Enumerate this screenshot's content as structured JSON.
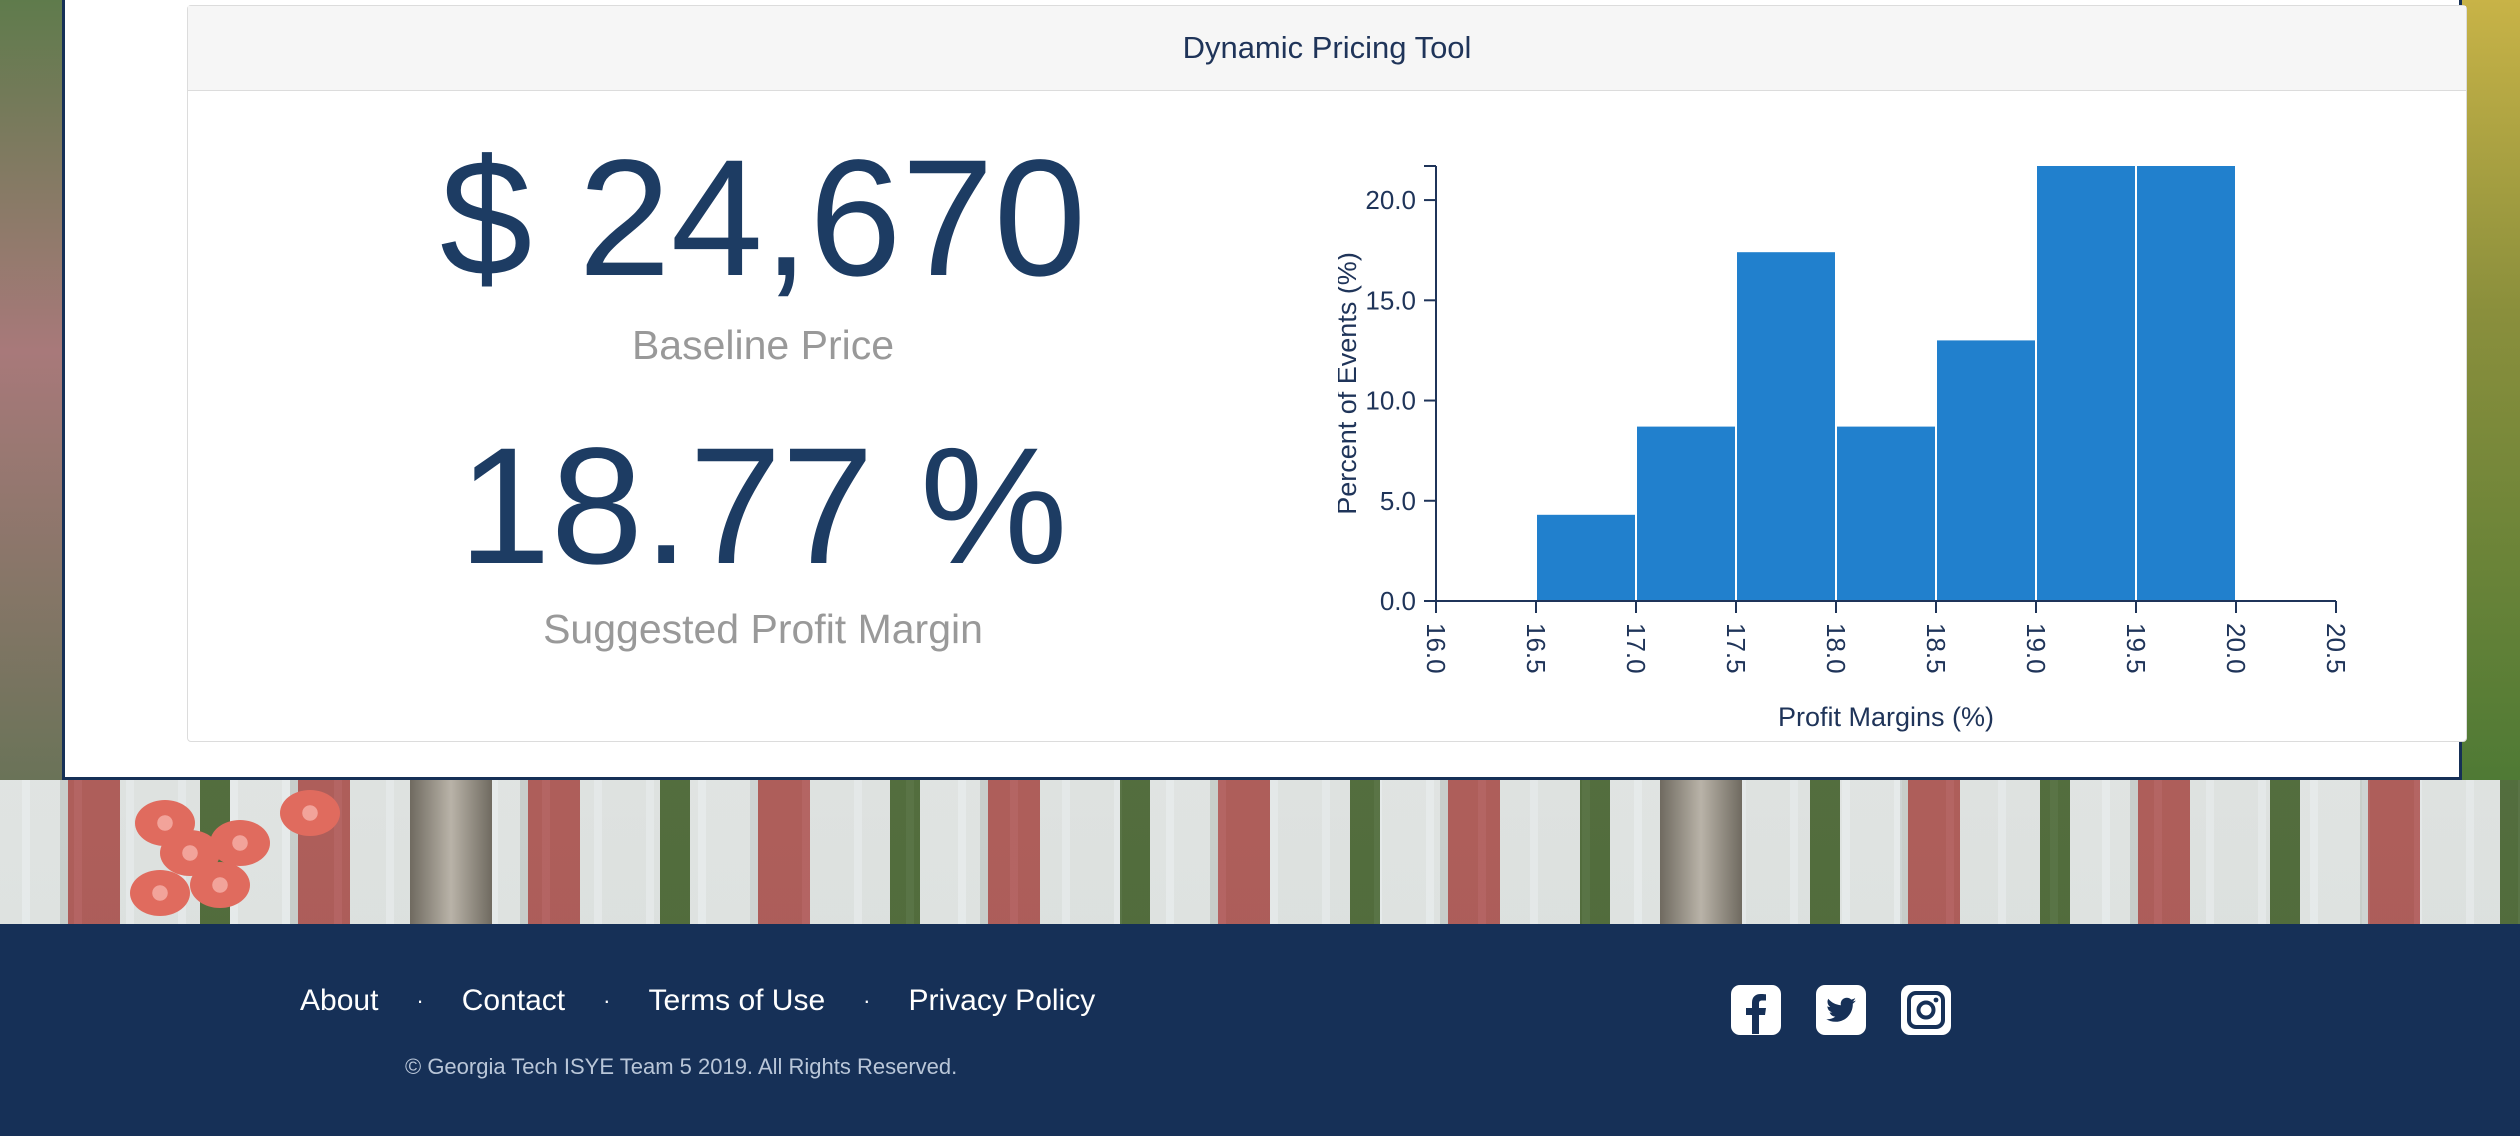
{
  "card": {
    "title": "Dynamic Pricing Tool"
  },
  "metrics": {
    "baseline_price": "$ 24,670",
    "baseline_label": "Baseline Price",
    "profit_margin": "18.77 %",
    "profit_margin_label": "Suggested Profit Margin"
  },
  "chart_data": {
    "type": "bar",
    "xlabel": "Profit Margins (%)",
    "ylabel": "Percent of Events (%)",
    "x_ticks": [
      "16.0",
      "16.5",
      "17.0",
      "17.5",
      "18.0",
      "18.5",
      "19.0",
      "19.5",
      "20.0",
      "20.5"
    ],
    "y_ticks": [
      "0.0",
      "5.0",
      "10.0",
      "15.0",
      "20.0"
    ],
    "xlim": [
      16.0,
      20.5
    ],
    "ylim": [
      0,
      21.7
    ],
    "bins": [
      {
        "x0": 16.5,
        "x1": 17.0,
        "value": 4.3
      },
      {
        "x0": 17.0,
        "x1": 17.5,
        "value": 8.7
      },
      {
        "x0": 17.5,
        "x1": 18.0,
        "value": 17.4
      },
      {
        "x0": 18.0,
        "x1": 18.5,
        "value": 8.7
      },
      {
        "x0": 18.5,
        "x1": 19.0,
        "value": 13.0
      },
      {
        "x0": 19.0,
        "x1": 19.5,
        "value": 21.7
      },
      {
        "x0": 19.5,
        "x1": 20.0,
        "value": 21.7
      }
    ],
    "bar_color": "#2180cd"
  },
  "footer": {
    "links": [
      "About",
      "Contact",
      "Terms of Use",
      "Privacy Policy"
    ],
    "separator": "·",
    "copyright": "© Georgia Tech ISYE Team 5 2019. All Rights Reserved.",
    "social_icons": [
      "facebook-icon",
      "twitter-icon",
      "instagram-icon"
    ]
  },
  "colors": {
    "navy": "#163057",
    "heading": "#1d3c63",
    "muted": "#999999"
  }
}
